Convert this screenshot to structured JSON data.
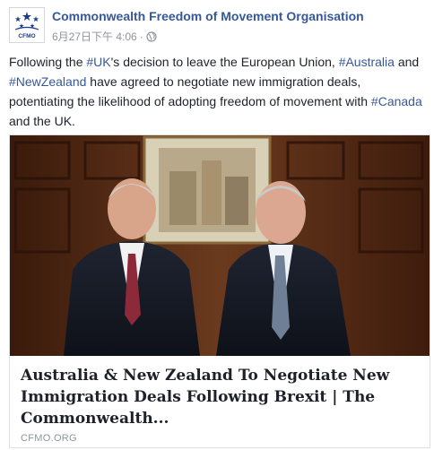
{
  "post": {
    "page_name": "Commonwealth Freedom of Movement Organisation",
    "timestamp": "6月27日下午 4:06",
    "separator": "·",
    "privacy_icon": "globe-icon",
    "avatar_text": "CFMO",
    "text": {
      "p1": "Following the ",
      "tag_uk": "#UK",
      "p2": "'s decision to leave the European Union, ",
      "tag_australia": "#Australia",
      "p3": " and ",
      "tag_nz": "#NewZealand",
      "p4": " have agreed to negotiate new immigration deals, potentiating the likelihood of adopting freedom of movement with ",
      "tag_canada": "#Canada",
      "p5": " and the UK."
    }
  },
  "link_card": {
    "title": "Australia & New Zealand To Negotiate New Immigration Deals Following Brexit | The Commonwealth...",
    "domain": "CFMO.ORG"
  },
  "colors": {
    "link_blue": "#365899",
    "text": "#1d2129",
    "meta_gray": "#90949c",
    "panel_wood": "#5a2e17"
  }
}
